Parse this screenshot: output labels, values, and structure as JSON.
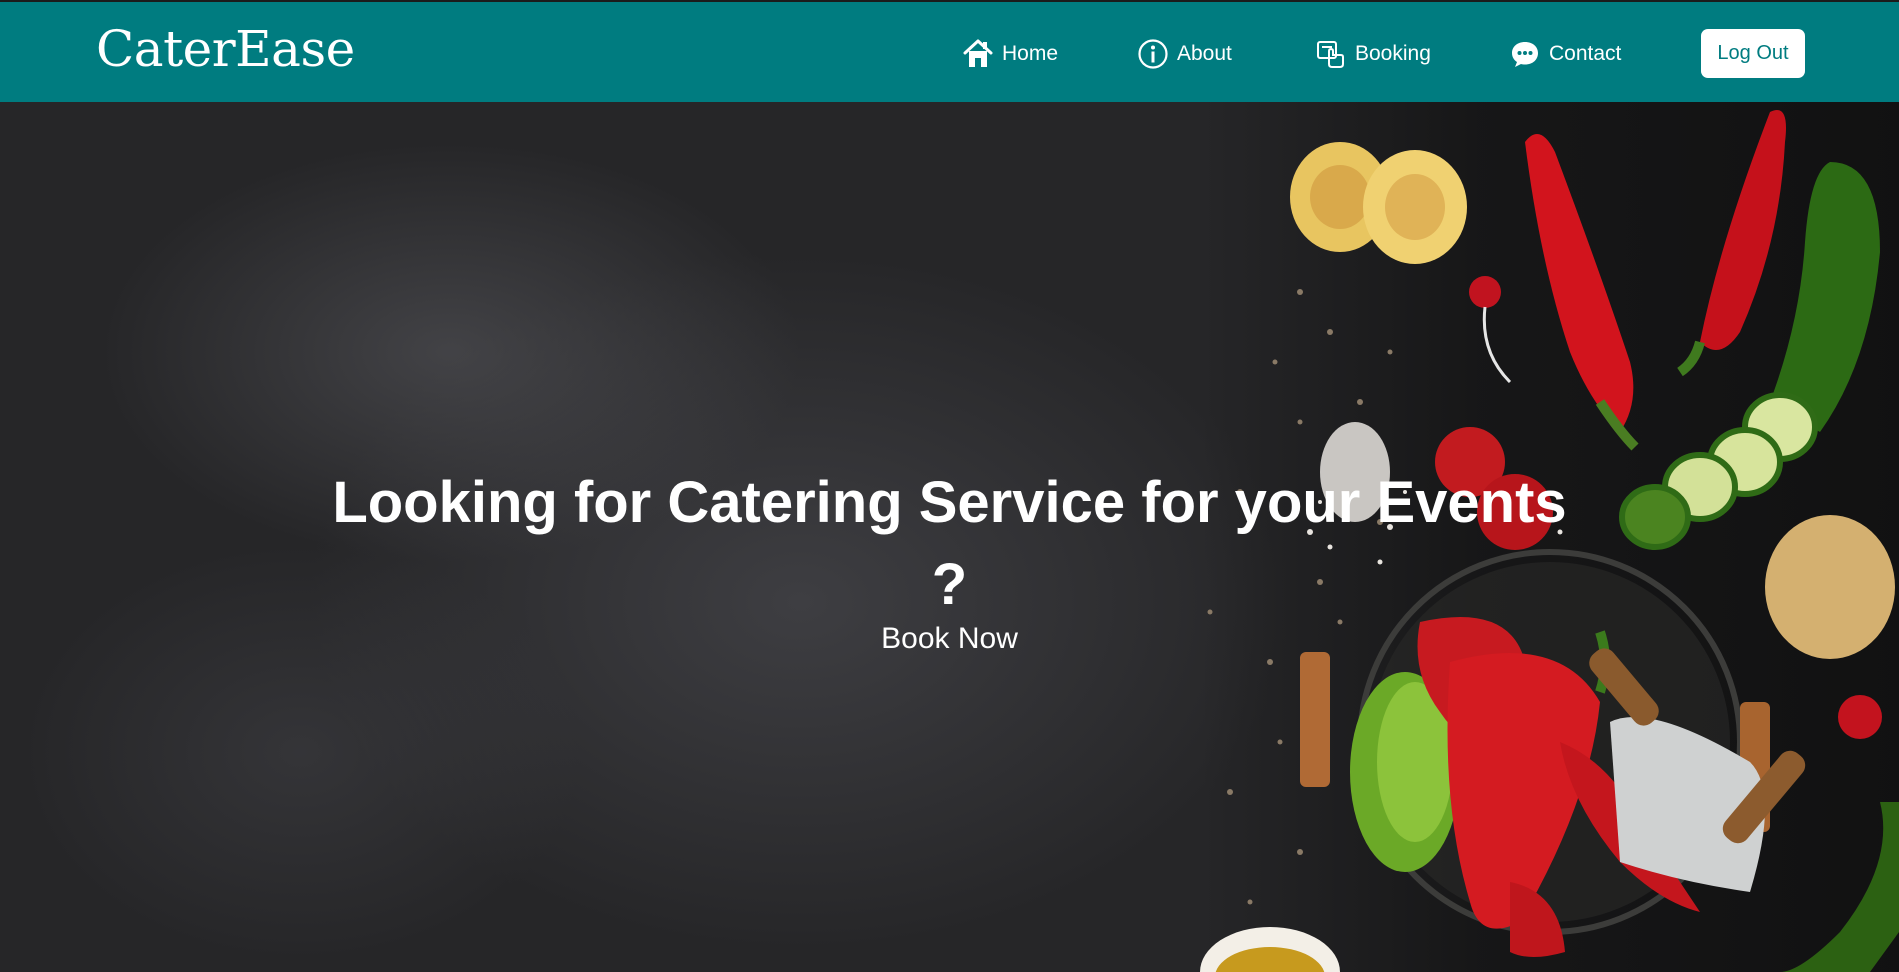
{
  "brand": {
    "name": "CaterEase"
  },
  "nav": {
    "home": {
      "label": "Home",
      "icon": "home-icon"
    },
    "about": {
      "label": "About",
      "icon": "info-icon"
    },
    "booking": {
      "label": "Booking",
      "icon": "booking-icon"
    },
    "contact": {
      "label": "Contact",
      "icon": "chat-icon"
    },
    "logout": {
      "label": "Log Out"
    }
  },
  "hero": {
    "headline_line1": "Looking for Catering Service for your Events",
    "headline_line2": "?",
    "cta": "Book Now"
  },
  "colors": {
    "navbar": "#007c80",
    "logout_bg": "#ffffff",
    "logout_text": "#007c80",
    "hero_bg": "#2a2a2c"
  }
}
